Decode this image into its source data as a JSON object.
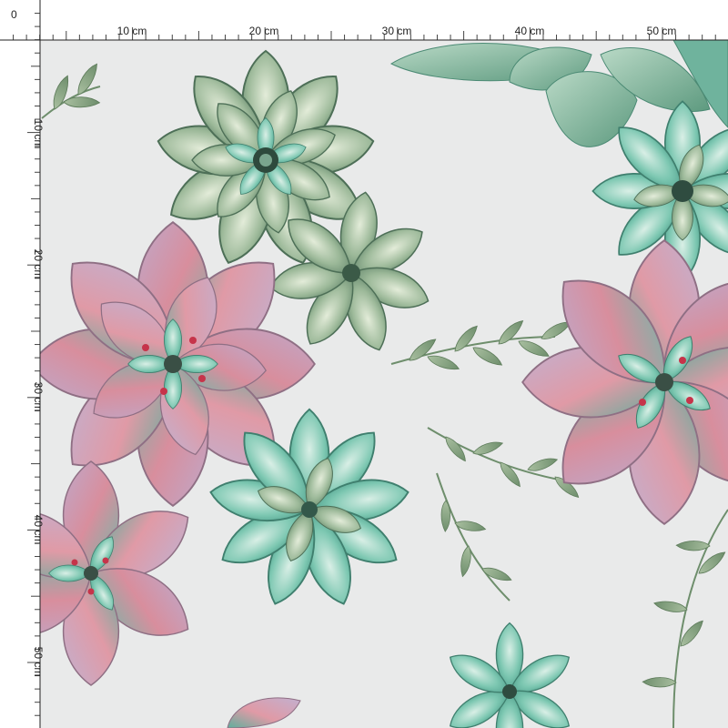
{
  "ruler": {
    "origin_label": "0",
    "top_labels": [
      "10 cm",
      "20 cm",
      "30 cm",
      "40 cm",
      "50 cm"
    ],
    "left_labels": [
      "10 cm",
      "20 cm",
      "30 cm",
      "40 cm",
      "50 cm"
    ],
    "unit": "cm"
  },
  "fabric": {
    "pattern": "watercolor succulents",
    "colors": {
      "background": "#e9eaea",
      "mint": "#7cc7b1",
      "teal": "#3e9f8c",
      "sage": "#8aa889",
      "deep_green": "#4d6f57",
      "pink": "#d98b98",
      "lilac": "#b7a4c1",
      "red_tip": "#c6344a"
    }
  }
}
